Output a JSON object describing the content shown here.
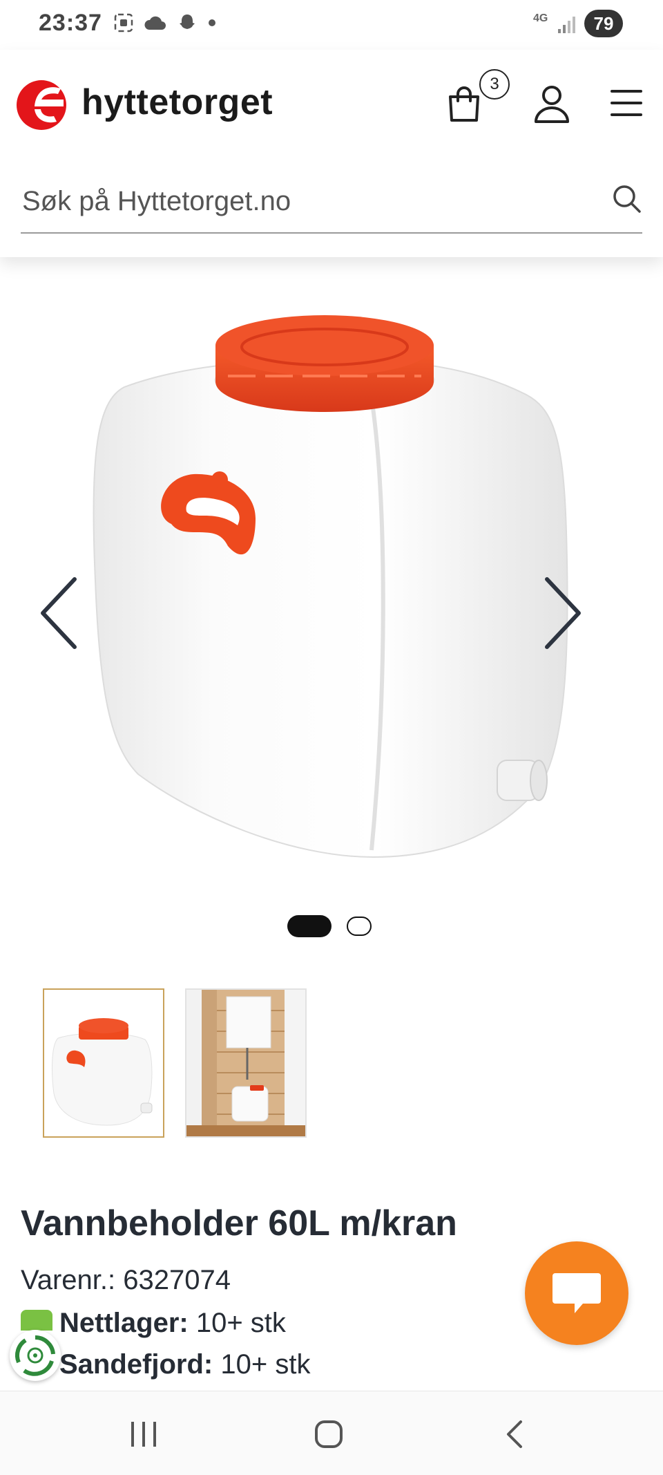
{
  "status_bar": {
    "time": "23:37",
    "network": "4G",
    "battery": "79"
  },
  "header": {
    "brand": "hyttetorget",
    "cart_count": "3"
  },
  "search": {
    "placeholder": "Søk på Hyttetorget.no"
  },
  "gallery": {
    "slide_count": 2,
    "active_slide": 1
  },
  "product": {
    "title": "Vannbeholder 60L m/kran",
    "sku_label": "Varenr.:",
    "sku": "6327074",
    "stock": [
      {
        "location": "Nettlager:",
        "qty": "10+ stk"
      },
      {
        "location": "Sandefjord:",
        "qty": "10+ stk"
      }
    ]
  },
  "colors": {
    "brand_red": "#e3151a",
    "tank_cap": "#ee4a1e",
    "chat_orange": "#f5821f",
    "stock_green": "#7ac143",
    "thumb_active_border": "#c9a25a"
  },
  "icons": [
    "app-icons",
    "cloud-icon",
    "snapchat-icon",
    "signal-icon",
    "cart-icon",
    "user-icon",
    "menu-icon",
    "search-icon",
    "chevron-left-icon",
    "chevron-right-icon",
    "chat-icon",
    "eco-icon",
    "recents-icon",
    "home-icon",
    "back-icon"
  ]
}
